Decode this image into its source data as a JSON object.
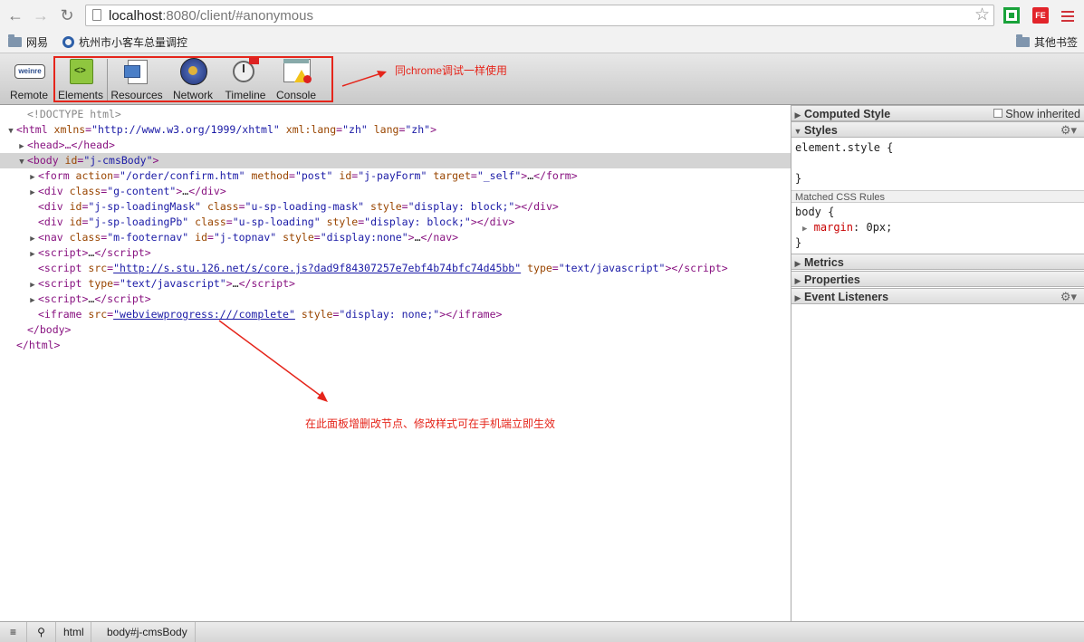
{
  "browser": {
    "url_host": "localhost",
    "url_rest": ":8080/client/#anonymous",
    "fe_label": "FE"
  },
  "bookmarks": {
    "items": [
      "网易",
      "杭州市小客车总量调控"
    ],
    "right": "其他书签"
  },
  "toolbar": {
    "remote": "Remote",
    "weinre": "weinre",
    "tabs": [
      "Elements",
      "Resources",
      "Network",
      "Timeline",
      "Console"
    ]
  },
  "annotations": {
    "top_note": "同chrome调试一样使用",
    "panel_note": "在此面板增删改节点、修改样式可在手机端立即生效"
  },
  "dom": {
    "doctype": "<!DOCTYPE html>",
    "html_open": {
      "tag": "html",
      "attrs": [
        [
          "xmlns",
          "http://www.w3.org/1999/xhtml"
        ],
        [
          "xml:lang",
          "zh"
        ],
        [
          "lang",
          "zh"
        ]
      ]
    },
    "head": "<head>…</head>",
    "body_open": {
      "tag": "body",
      "attrs": [
        [
          "id",
          "j-cmsBody"
        ]
      ]
    },
    "children": [
      {
        "tri": "▶",
        "tag": "form",
        "attrs": [
          [
            "action",
            "/order/confirm.htm"
          ],
          [
            "method",
            "post"
          ],
          [
            "id",
            "j-payForm"
          ],
          [
            "target",
            "_self"
          ]
        ],
        "inner": "…",
        "close": true
      },
      {
        "tri": "▶",
        "tag": "div",
        "attrs": [
          [
            "class",
            "g-content"
          ]
        ],
        "inner": "…",
        "close": true
      },
      {
        "tri": "",
        "tag": "div",
        "attrs": [
          [
            "id",
            "j-sp-loadingMask"
          ],
          [
            "class",
            "u-sp-loading-mask"
          ],
          [
            "style",
            "display: block;"
          ]
        ],
        "inner": "",
        "close": true
      },
      {
        "tri": "",
        "tag": "div",
        "attrs": [
          [
            "id",
            "j-sp-loadingPb"
          ],
          [
            "class",
            "u-sp-loading"
          ],
          [
            "style",
            "display: block;"
          ]
        ],
        "inner": "",
        "close": true
      },
      {
        "tri": "▶",
        "tag": "nav",
        "attrs": [
          [
            "class",
            "m-footernav"
          ],
          [
            "id",
            "j-topnav"
          ],
          [
            "style",
            "display:none"
          ]
        ],
        "inner": "…",
        "close": true
      },
      {
        "tri": "▶",
        "tag": "script",
        "attrs": [],
        "inner": "…",
        "close": true
      },
      {
        "tri": "",
        "tag": "script",
        "attrs": [
          [
            "src",
            "http://s.stu.126.net/s/core.js?dad9f84307257e7ebf4b74bfc74d45bb",
            "link"
          ],
          [
            "type",
            "text/javascript"
          ]
        ],
        "inner": "",
        "close": true
      },
      {
        "tri": "▶",
        "tag": "script",
        "attrs": [
          [
            "type",
            "text/javascript"
          ]
        ],
        "inner": "…",
        "close": true
      },
      {
        "tri": "▶",
        "tag": "script",
        "attrs": [],
        "inner": "…",
        "close": true
      },
      {
        "tri": "",
        "tag": "iframe",
        "attrs": [
          [
            "src",
            "webviewprogress:///complete",
            "link"
          ],
          [
            "style",
            "display: none;"
          ]
        ],
        "inner": "",
        "close": true
      }
    ],
    "body_close": "</body>",
    "html_close": "</html>"
  },
  "sidebar": {
    "computed_style": "Computed Style",
    "show_inherited": "Show inherited",
    "styles": "Styles",
    "element_style_open": "element.style {",
    "element_style_close": "}",
    "matched_rules": "Matched CSS Rules",
    "rule_selector": "body {",
    "rule_prop": "margin",
    "rule_val": "0px;",
    "rule_close": "}",
    "metrics": "Metrics",
    "properties": "Properties",
    "event_listeners": "Event Listeners"
  },
  "status": {
    "crumbs": [
      "html",
      "body#j-cmsBody"
    ]
  }
}
